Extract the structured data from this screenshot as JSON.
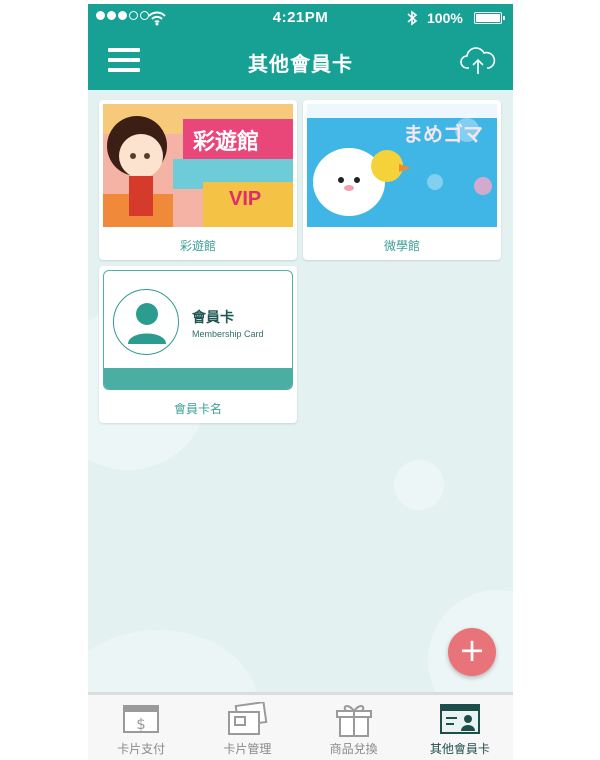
{
  "status_bar": {
    "time": "4:21PM",
    "battery": "100%"
  },
  "header": {
    "title": "其他會員卡"
  },
  "cards": [
    {
      "label": "彩遊館",
      "image_text": "彩遊館",
      "image_sub": "VIP"
    },
    {
      "label": "微學館",
      "image_text": "まめゴマ"
    },
    {
      "label": "會員卡名",
      "card_title": "會員卡",
      "card_subtitle": "Membership Card"
    }
  ],
  "fab": {
    "label": "+"
  },
  "tabbar": {
    "items": [
      {
        "label": "卡片支付",
        "icon": "card-payment-icon",
        "active": false
      },
      {
        "label": "卡片管理",
        "icon": "card-management-icon",
        "active": false
      },
      {
        "label": "商品兌換",
        "icon": "gift-icon",
        "active": false
      },
      {
        "label": "其他會員卡",
        "icon": "member-card-icon",
        "active": true
      }
    ]
  },
  "colors": {
    "primary": "#17a194",
    "background": "#e4f1f1",
    "fab": "#e8747a",
    "card_band": "#4aaea3"
  }
}
